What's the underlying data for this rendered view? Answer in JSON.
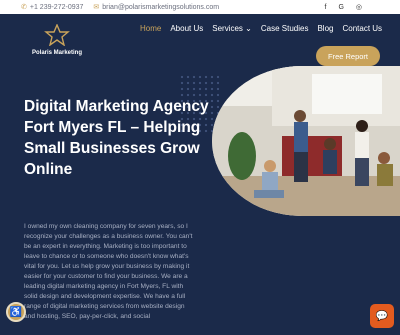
{
  "topbar": {
    "phone": "+1 239-272-0937",
    "email": "brian@polarismarketingsolutions.com",
    "phone_icon": "phone-icon",
    "email_icon": "mail-icon",
    "social": [
      "facebook-icon",
      "google-icon",
      "instagram-icon"
    ],
    "social_glyphs": [
      "f",
      "G",
      "◎"
    ]
  },
  "logo": {
    "text": "Polaris Marketing"
  },
  "nav": {
    "items": [
      {
        "label": "Home",
        "active": true
      },
      {
        "label": "About Us",
        "active": false
      },
      {
        "label": "Services ⌄",
        "active": false
      },
      {
        "label": "Case Studies",
        "active": false
      },
      {
        "label": "Blog",
        "active": false
      },
      {
        "label": "Contact Us",
        "active": false
      }
    ],
    "cta": "Free Report"
  },
  "hero": {
    "title": "Digital Marketing Agency Fort Myers FL – Helping Small Businesses Grow Online",
    "body": "I owned my own cleaning company for seven years, so I recognize your challenges as a business owner. You can't be an expert in everything. Marketing is too important to leave to chance or to someone who doesn't know what's vital for you. Let us help grow your business by making it easier for your customer to find your business. We are a leading digital marketing agency in Fort Myers, FL with solid design and development expertise. We have a full range of digital marketing services from website design and hosting, SEO, pay-per-click, and social"
  },
  "colors": {
    "navy": "#1b2a4a",
    "gold": "#c9a35b",
    "chat": "#e35b1f"
  }
}
